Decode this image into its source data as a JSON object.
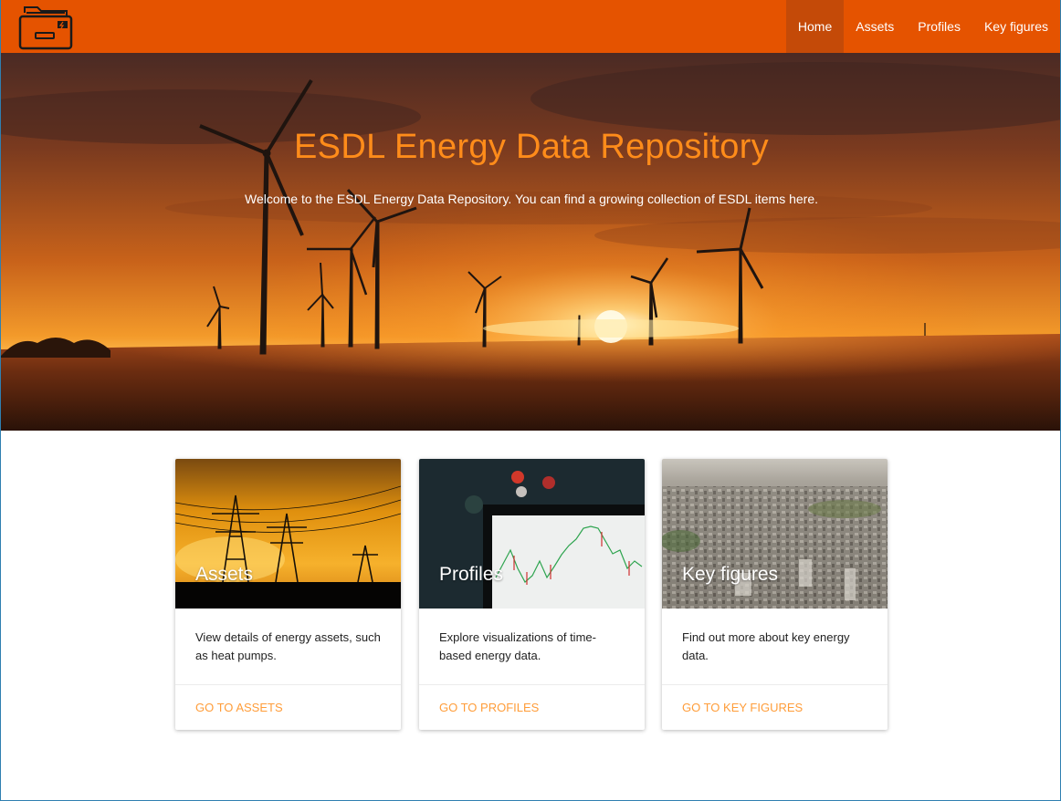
{
  "nav": {
    "links": [
      {
        "label": "Home",
        "active": true
      },
      {
        "label": "Assets",
        "active": false
      },
      {
        "label": "Profiles",
        "active": false
      },
      {
        "label": "Key figures",
        "active": false
      }
    ]
  },
  "logo": {
    "icon": "file-cabinet-icon"
  },
  "hero": {
    "title": "ESDL Energy Data Repository",
    "subtitle": "Welcome to the ESDL Energy Data Repository. You can find a growing collection of ESDL items here."
  },
  "cards": [
    {
      "title": "Assets",
      "text": "View details of energy assets, such as heat pumps.",
      "link": "GO TO ASSETS"
    },
    {
      "title": "Profiles",
      "text": "Explore visualizations of time-based energy data.",
      "link": "GO TO PROFILES"
    },
    {
      "title": "Key figures",
      "text": "Find out more about key energy data.",
      "link": "GO TO KEY FIGURES"
    }
  ],
  "colors": {
    "brand": "#e55300",
    "active_nav": "#c44a08",
    "hero_title": "#ff8c1a",
    "card_link": "#ff9d3a"
  }
}
